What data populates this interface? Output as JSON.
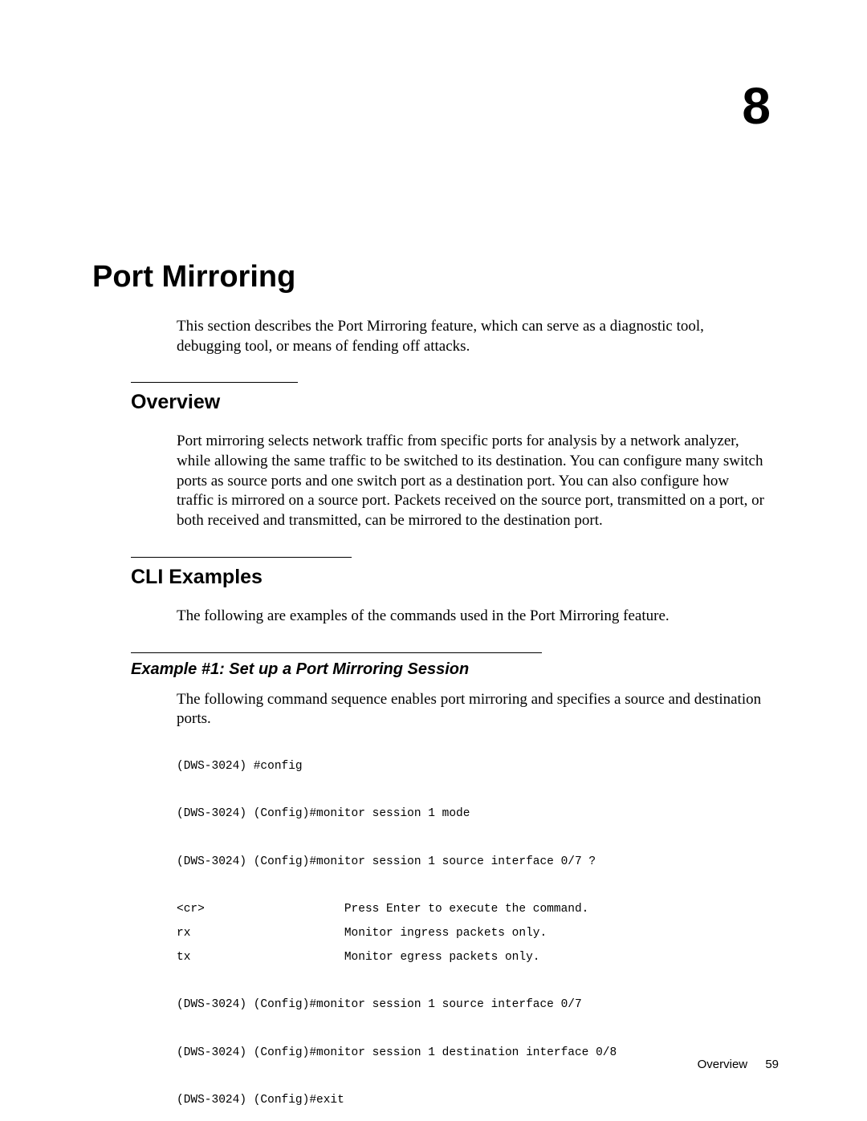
{
  "chapter": {
    "number": "8",
    "title": "Port Mirroring",
    "intro": "This section describes the Port Mirroring feature, which can serve as a diagnostic tool, debugging tool, or means of fending off attacks."
  },
  "sections": {
    "overview": {
      "heading": "Overview",
      "body": "Port mirroring selects network traffic from specific ports for analysis by a network analyzer, while allowing the same traffic to be switched to its destination. You can configure many switch ports as source ports and one switch port as a destination port. You can also configure how traffic is mirrored on a source port. Packets received on the source port, transmitted on a port, or both received and transmitted, can be mirrored to the destination port."
    },
    "cli_examples": {
      "heading": "CLI Examples",
      "intro": "The following are examples of the commands used in the Port Mirroring feature.",
      "example1": {
        "heading": "Example #1: Set up a Port Mirroring Session",
        "description": "The following command sequence enables port mirroring and specifies a source and destination ports.",
        "code": "(DWS-3024) #config\n\n(DWS-3024) (Config)#monitor session 1 mode\n\n(DWS-3024) (Config)#monitor session 1 source interface 0/7 ?\n\n<cr>                    Press Enter to execute the command.\nrx                      Monitor ingress packets only.\ntx                      Monitor egress packets only.\n\n(DWS-3024) (Config)#monitor session 1 source interface 0/7\n\n(DWS-3024) (Config)#monitor session 1 destination interface 0/8\n\n(DWS-3024) (Config)#exit"
      }
    }
  },
  "footer": {
    "section_name": "Overview",
    "page_number": "59"
  }
}
